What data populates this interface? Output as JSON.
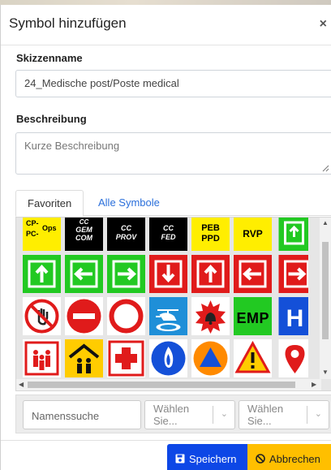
{
  "dialog": {
    "title": "Symbol hinzufügen",
    "close_label": "×"
  },
  "sketch_name": {
    "label": "Skizzenname",
    "value": "24_Medische post/Poste medical"
  },
  "description": {
    "label": "Beschreibung",
    "placeholder": "Kurze Beschreibung"
  },
  "tabs": [
    {
      "label": "Favoriten",
      "active": true
    },
    {
      "label": "Alle Symbole",
      "active": false
    }
  ],
  "symbols_row1": [
    {
      "name": "cp-pc-ops",
      "lines": [
        "CP-",
        "PC-",
        "Ops"
      ]
    },
    {
      "name": "cc-gem-com",
      "lines": [
        "CC",
        "GEM",
        "COM"
      ]
    },
    {
      "name": "cc-prov",
      "lines": [
        "CC",
        "PROV"
      ]
    },
    {
      "name": "cc-fed",
      "lines": [
        "CC",
        "FED"
      ]
    },
    {
      "name": "peb-ppd",
      "lines": [
        "PEB",
        "PPD"
      ]
    },
    {
      "name": "rvp",
      "lines": [
        "RVP"
      ]
    }
  ],
  "symbols_row3": [
    {
      "name": "emp-text",
      "text": "E M P"
    },
    {
      "name": "hospital-text",
      "text": "H"
    }
  ],
  "filters": {
    "search_placeholder": "Namenssuche",
    "select1_placeholder": "Wählen Sie...",
    "select2_placeholder": "Wählen Sie..."
  },
  "footer": {
    "save_label": "Speichern",
    "cancel_label": "Abbrechen"
  },
  "colors": {
    "primary": "#0d47e6",
    "warning": "#ffbf00",
    "link": "#2a6fdb",
    "symbol_green": "#22c922",
    "symbol_red": "#e01b1b",
    "symbol_yellow": "#ffee00",
    "symbol_blue": "#1450d8"
  }
}
